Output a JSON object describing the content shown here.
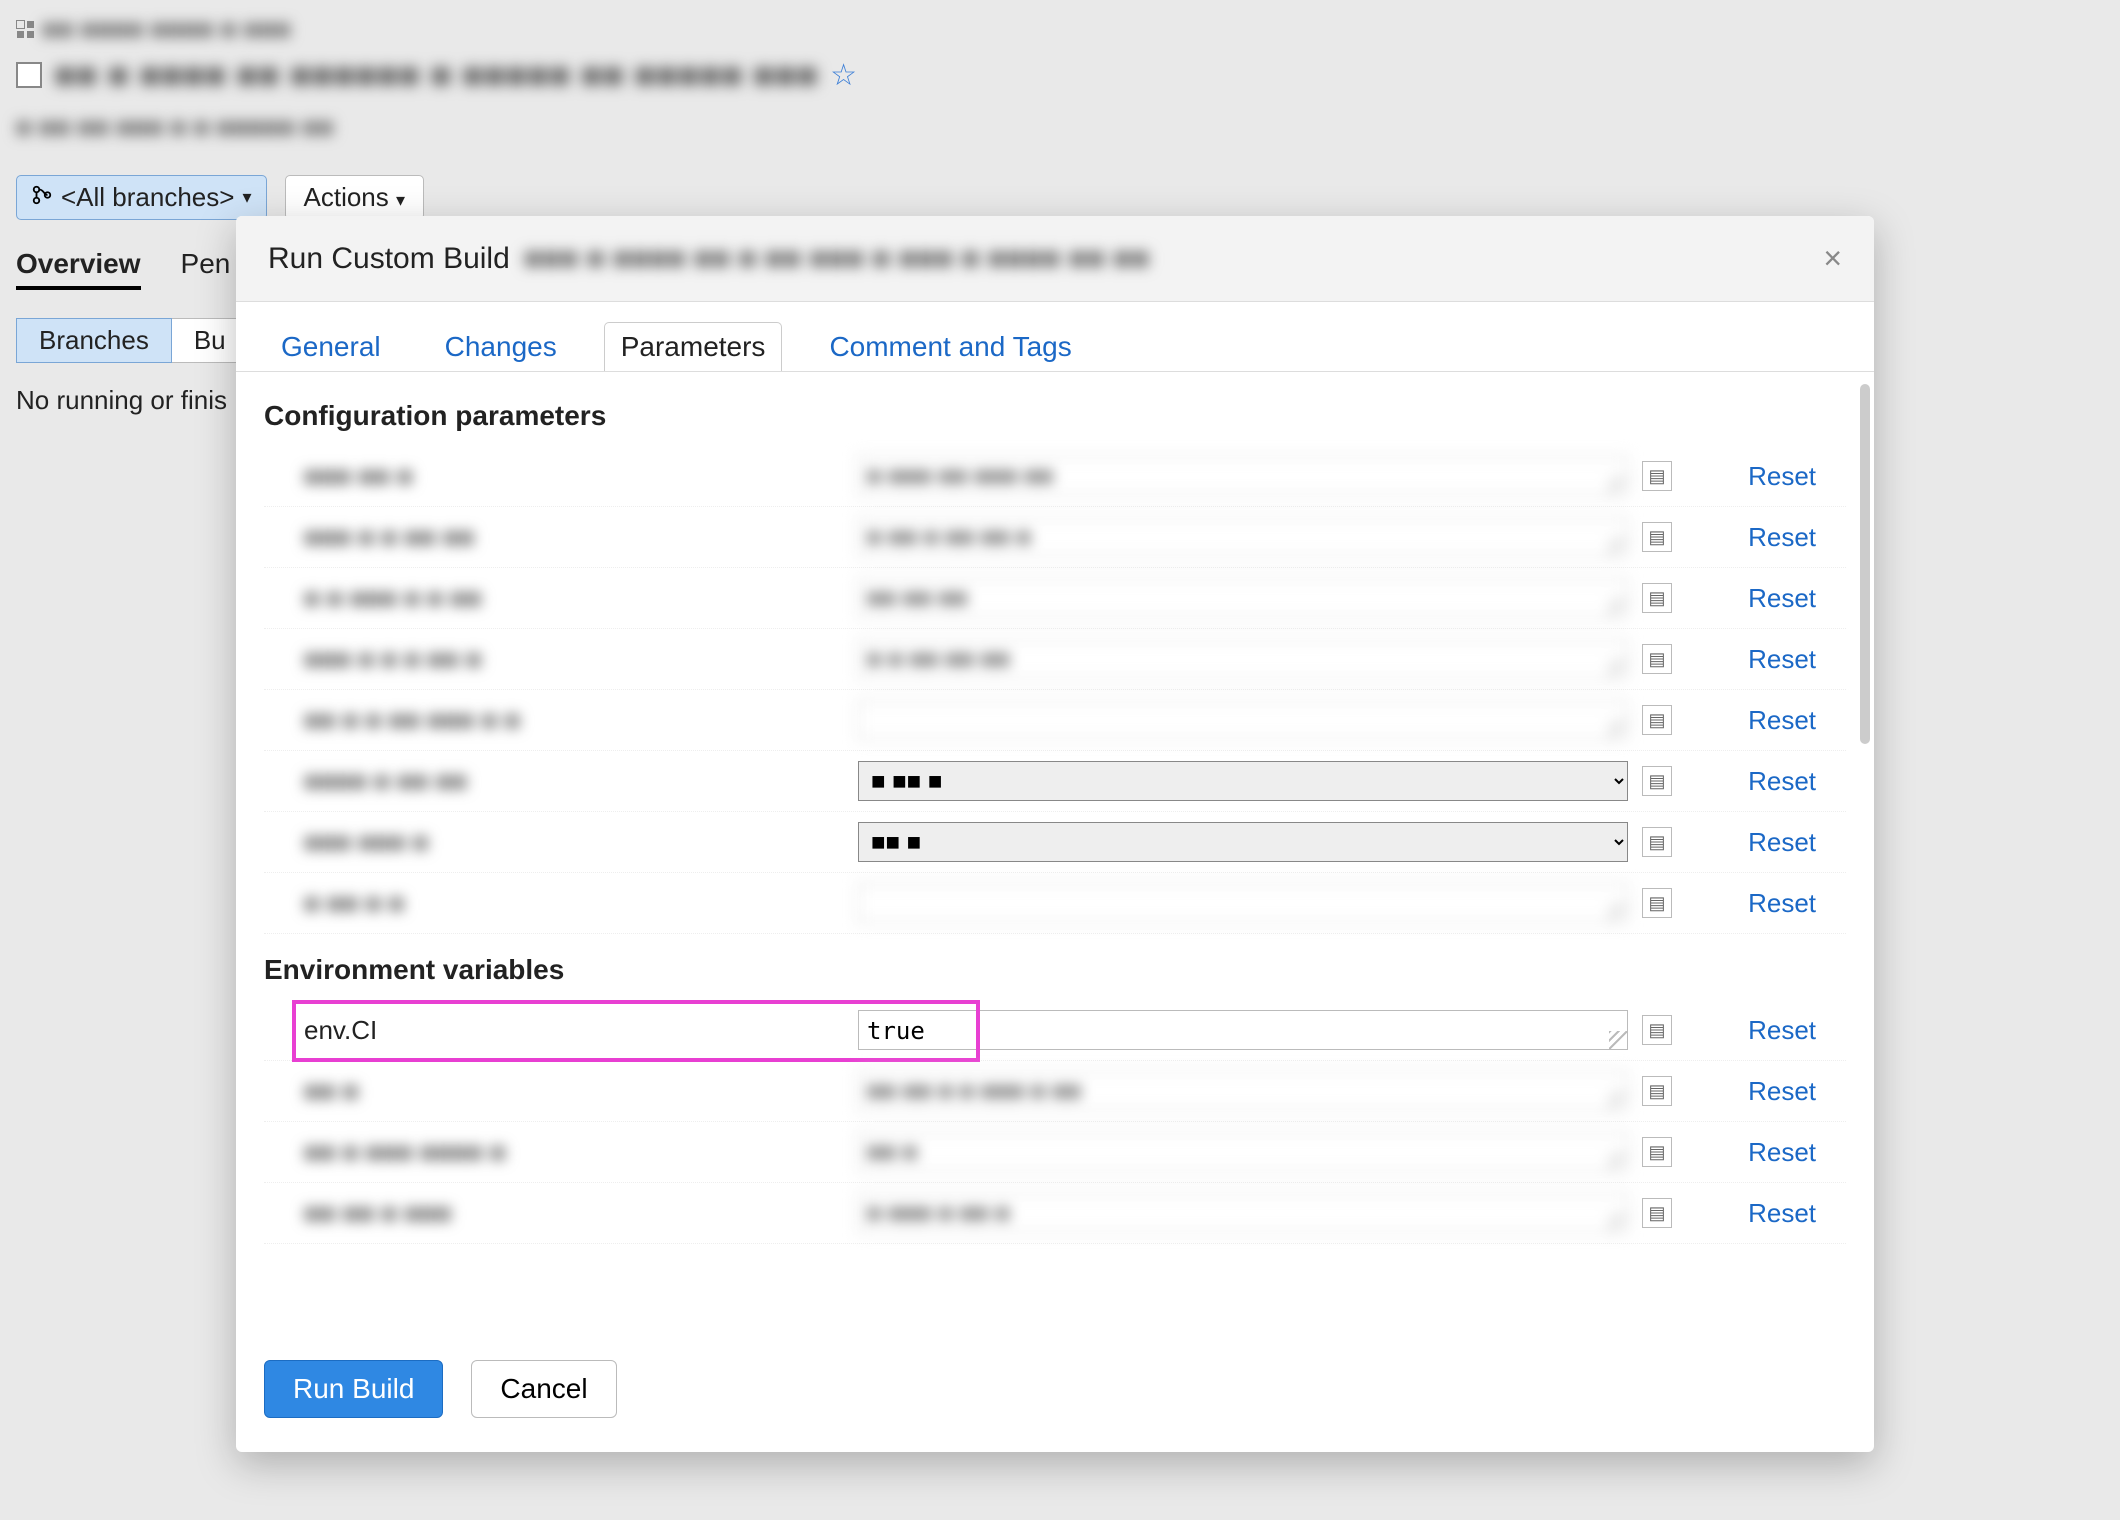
{
  "bg": {
    "breadcrumb_blur": "■■ ■■■■ ■■■■ ■ ■■■",
    "title_blur": "■■ ■ ■■■■ ■■ ■■■■■■ ■ ■■■■■ ■■ ■■■■■ ■■■",
    "sub_blur": "■ ■■ ■■ ■■■ ■ ■ ■■■■■ ■■",
    "branch_label": "<All branches>",
    "actions_label": "Actions",
    "tabs": {
      "overview": "Overview",
      "pen": "Pen"
    },
    "seg_branches": "Branches",
    "seg_bu": "Bu",
    "no_running": "No running or finis"
  },
  "modal": {
    "title": "Run Custom Build",
    "title_blur": "■■■ ■ ■■■■ ■■ ■ ■■ ■■■ ■ ■■■ ■ ■■■■ ■■ ■■",
    "tabs": {
      "general": "General",
      "changes": "Changes",
      "parameters": "Parameters",
      "comment": "Comment and Tags"
    },
    "section_config": "Configuration parameters",
    "section_env": "Environment variables",
    "reset": "Reset",
    "config_rows": [
      {
        "name": "■■■ ■■ ■",
        "value": "■ ■■■ ■■ ■■■ ■■",
        "type": "text"
      },
      {
        "name": "■■■ ■ ■ ■■ ■■",
        "value": "■ ■■ ■ ■■ ■■ ■",
        "type": "text"
      },
      {
        "name": "■ ■ ■■■ ■ ■ ■■",
        "value": "■■ ■■ ■■",
        "type": "text"
      },
      {
        "name": "■■■ ■ ■ ■ ■■ ■",
        "value": "■ ■ ■■ ■■ ■■",
        "type": "text"
      },
      {
        "name": "■■ ■ ■ ■■ ■■■ ■ ■",
        "value": "",
        "type": "text"
      },
      {
        "name": "■■■■ ■ ■■ ■■",
        "value": "■ ■■ ■",
        "type": "select"
      },
      {
        "name": "■■■ ■■■ ■",
        "value": "■■ ■",
        "type": "select"
      },
      {
        "name": "■ ■■ ■ ■",
        "value": "",
        "type": "text"
      }
    ],
    "env_rows": [
      {
        "name": "env.CI",
        "value": "true"
      },
      {
        "name": "■■ ■",
        "value": "■■ ■■ ■ ■ ■■■ ■ ■■"
      },
      {
        "name": "■■ ■ ■■■ ■■■■ ■",
        "value": "■■ ■"
      },
      {
        "name": "■■ ■■ ■ ■■■",
        "value": "■ ■■■ ■ ■■ ■"
      }
    ],
    "run_label": "Run Build",
    "cancel_label": "Cancel"
  }
}
